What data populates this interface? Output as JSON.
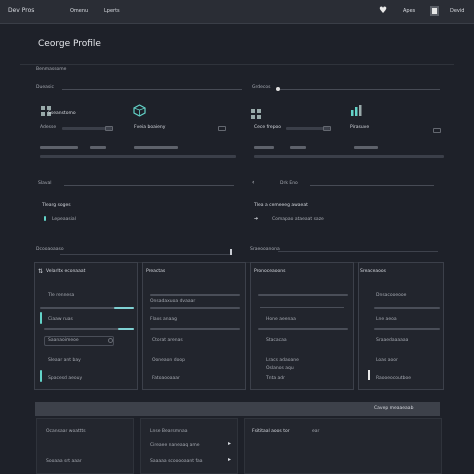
{
  "topbar": {
    "logo_text": "Dev Pros",
    "nav": [
      "Omenu",
      "Lperts"
    ],
    "right_label": "Apes",
    "far_label": "Devid"
  },
  "page": {
    "title": "Ceorge Profile"
  },
  "section1": {
    "label": "Benmassome"
  },
  "cards_top": {
    "left_header": "Dueasic",
    "right_header": "Grdecos",
    "cards": [
      {
        "icon": "grid-icon",
        "name": "Sseanstomo",
        "label": "Adesse"
      },
      {
        "icon": "cube-icon",
        "name": "Fveia boaieny",
        "label": ""
      },
      {
        "icon": "grid-icon",
        "name": "Cece frepoo",
        "label": ""
      },
      {
        "icon": "chart-icon",
        "name": "Pirasuve",
        "label": ""
      }
    ]
  },
  "section2": {
    "left_label": "Slaval",
    "right_label": "Drk Eno",
    "left_title": "Tlearg soges",
    "left_item": "Lepeaasial",
    "right_title": "Tlea a cemeeeg awaeat",
    "right_item": "Comapao ataeaat saze"
  },
  "section3": {
    "label_left": "Dcooaoaaso",
    "label_mid": "Sraeooanona",
    "columns": [
      {
        "title": "Velarltx econaaat",
        "rows": [
          "Tle rennesa",
          "Ciaaw ruas",
          "Saanaoimeoe",
          "Sleaar ant bay",
          "Spacesd aeouy"
        ]
      },
      {
        "title": "Preactas",
        "rows": [
          "Onsadaxuoa dvaaar",
          "Flaxs anaag",
          "Ctorat arenas",
          "Ooneaon doop",
          "Fatoaooaaar"
        ]
      },
      {
        "title": "Pronoceaoons",
        "rows": [
          "Hone aeenaa",
          "Stacacaa",
          "Lracs adaoane",
          "Oslanos aqu",
          "Tnta adr"
        ]
      },
      {
        "title": "Sreaceaoos",
        "rows": [
          "Dnsacooeooe",
          "Lne aeoa",
          "Sraaedaaaaaa",
          "Loas aoor",
          "Raooeocoutboe"
        ]
      }
    ]
  },
  "bottom": {
    "band_label": "Cavep meaaeaab",
    "left_rows": [
      "Ocansaar woattts",
      "Sooaaa srt aaar"
    ],
    "mid_rows": [
      "Lnse Bearsmnaa",
      "Cireaee naneaaq ame",
      "Saaaaa scooooaant faa"
    ],
    "right_title": "Fsititaal aoos tor",
    "right_tag": "ear"
  },
  "colors": {
    "background": "#1e2129",
    "accent": "#63d3c8",
    "panel": "#22252d"
  }
}
